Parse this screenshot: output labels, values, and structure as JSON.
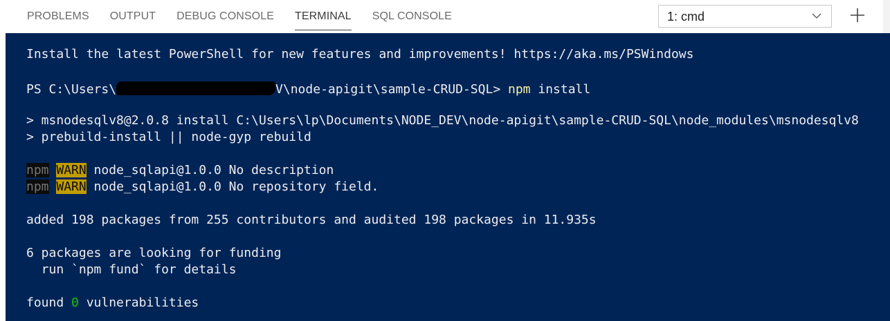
{
  "panel": {
    "tabs": [
      {
        "label": "PROBLEMS"
      },
      {
        "label": "OUTPUT"
      },
      {
        "label": "DEBUG CONSOLE"
      },
      {
        "label": "TERMINAL"
      },
      {
        "label": "SQL CONSOLE"
      }
    ],
    "active_tab": "TERMINAL",
    "terminal_select": {
      "value": "1: cmd",
      "icon": "chevron-down-icon"
    },
    "new_terminal_icon": "plus-icon"
  },
  "terminal": {
    "background": "#012456",
    "line1": "Install the latest PowerShell for new features and improvements! https://aka.ms/PSWindows",
    "prompt": {
      "prefix": "PS C:\\Users\\",
      "suffix": "V\\node-apigit\\sample-CRUD-SQL> ",
      "command": "npm",
      "args": " install"
    },
    "script_line1": "> msnodesqlv8@2.0.8 install C:\\Users\\lp\\Documents\\NODE_DEV\\node-apigit\\sample-CRUD-SQL\\node_modules\\msnodesqlv8",
    "script_line2": "> prebuild-install || node-gyp rebuild",
    "warn1": {
      "npm": "npm",
      "warn": "WARN",
      "text": " node_sqlapi@1.0.0 No description"
    },
    "warn2": {
      "npm": "npm",
      "warn": "WARN",
      "text": " node_sqlapi@1.0.0 No repository field."
    },
    "added_line": "added 198 packages from 255 contributors and audited 198 packages in 11.935s",
    "funding_line1": "6 packages are looking for funding",
    "funding_line2": "  run `npm fund` for details",
    "found": {
      "prefix": "found ",
      "count": "0",
      "suffix": " vulnerabilities"
    }
  }
}
